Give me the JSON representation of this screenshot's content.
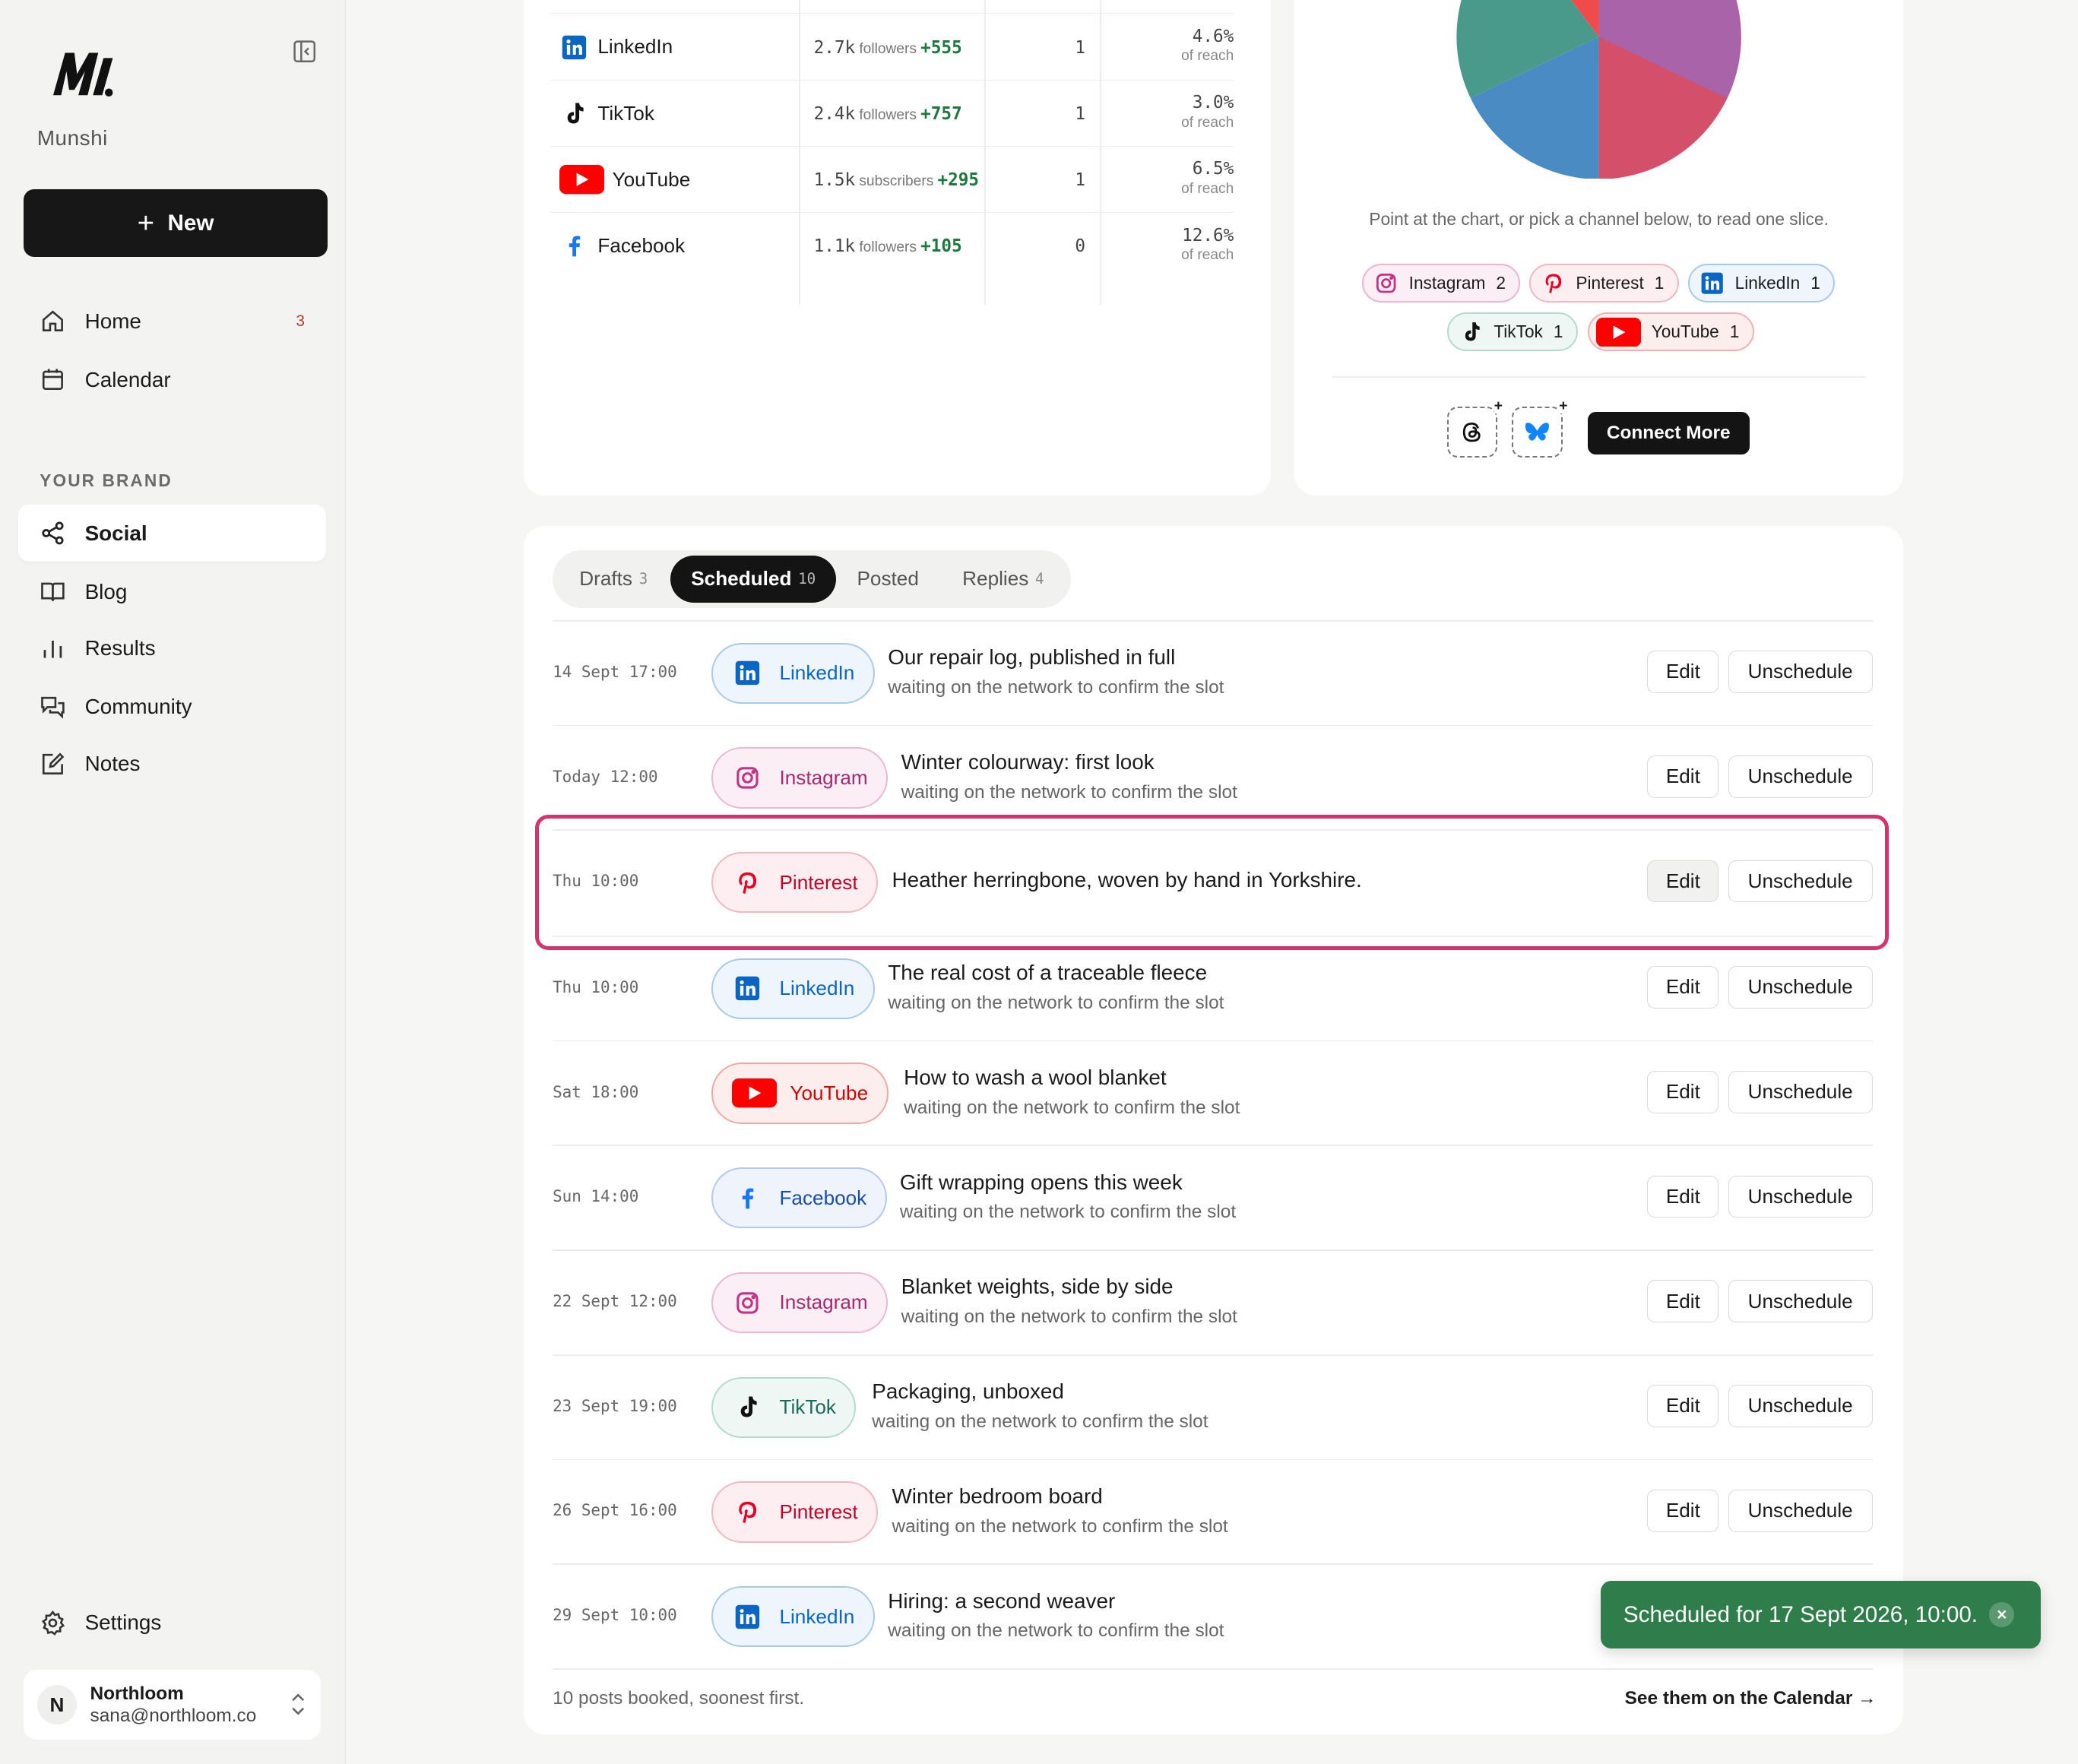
{
  "brand": {
    "name": "Munshi"
  },
  "sidebar": {
    "new_label": "New",
    "nav": [
      {
        "label": "Home",
        "badge": "3",
        "icon": "home-icon"
      },
      {
        "label": "Calendar",
        "icon": "calendar-icon"
      }
    ],
    "section_label": "YOUR BRAND",
    "brand_nav": [
      {
        "label": "Social",
        "icon": "share-icon",
        "active": true
      },
      {
        "label": "Blog",
        "icon": "book-icon"
      },
      {
        "label": "Results",
        "icon": "bar-chart-icon"
      },
      {
        "label": "Community",
        "icon": "chat-icon"
      },
      {
        "label": "Notes",
        "icon": "edit-note-icon"
      }
    ],
    "settings_label": "Settings",
    "account": {
      "initial": "N",
      "name": "Northloom",
      "email": "sana@northloom.co"
    }
  },
  "stats": {
    "rows": [
      {
        "network": "LinkedIn",
        "followers": "2.7k",
        "unit": "followers",
        "delta": "+555",
        "posts": "1",
        "reach": "4.6%",
        "reach_label": "of reach"
      },
      {
        "network": "TikTok",
        "followers": "2.4k",
        "unit": "followers",
        "delta": "+757",
        "posts": "1",
        "reach": "3.0%",
        "reach_label": "of reach"
      },
      {
        "network": "YouTube",
        "followers": "1.5k",
        "unit": "subscribers",
        "delta": "+295",
        "posts": "1",
        "reach": "6.5%",
        "reach_label": "of reach"
      },
      {
        "network": "Facebook",
        "followers": "1.1k",
        "unit": "followers",
        "delta": "+105",
        "posts": "0",
        "reach": "12.6%",
        "reach_label": "of reach"
      }
    ]
  },
  "pie": {
    "hint": "Point at the chart, or pick a channel below, to read one slice.",
    "chips": [
      {
        "label": "Instagram",
        "count": "2"
      },
      {
        "label": "Pinterest",
        "count": "1"
      },
      {
        "label": "LinkedIn",
        "count": "1"
      },
      {
        "label": "TikTok",
        "count": "1"
      },
      {
        "label": "YouTube",
        "count": "1"
      }
    ],
    "connect_label": "Connect More"
  },
  "tabs": [
    {
      "label": "Drafts",
      "count": "3"
    },
    {
      "label": "Scheduled",
      "count": "10",
      "active": true
    },
    {
      "label": "Posted",
      "count": ""
    },
    {
      "label": "Replies",
      "count": "4"
    }
  ],
  "posts": [
    {
      "when": "14 Sept 17:00",
      "network": "LinkedIn",
      "title": "Our repair log, published in full",
      "sub": "waiting on the network to confirm the slot"
    },
    {
      "when": "Today 12:00",
      "network": "Instagram",
      "title": "Winter colourway: first look",
      "sub": "waiting on the network to confirm the slot"
    },
    {
      "when": "Thu 10:00",
      "network": "Pinterest",
      "title": "Heather herringbone, woven by hand in Yorkshire.",
      "sub": ""
    },
    {
      "when": "Thu 10:00",
      "network": "LinkedIn",
      "title": "The real cost of a traceable fleece",
      "sub": "waiting on the network to confirm the slot"
    },
    {
      "when": "Sat 18:00",
      "network": "YouTube",
      "title": "How to wash a wool blanket",
      "sub": "waiting on the network to confirm the slot"
    },
    {
      "when": "Sun 14:00",
      "network": "Facebook",
      "title": "Gift wrapping opens this week",
      "sub": "waiting on the network to confirm the slot"
    },
    {
      "when": "22 Sept 12:00",
      "network": "Instagram",
      "title": "Blanket weights, side by side",
      "sub": "waiting on the network to confirm the slot"
    },
    {
      "when": "23 Sept 19:00",
      "network": "TikTok",
      "title": "Packaging, unboxed",
      "sub": "waiting on the network to confirm the slot"
    },
    {
      "when": "26 Sept 16:00",
      "network": "Pinterest",
      "title": "Winter bedroom board",
      "sub": "waiting on the network to confirm the slot"
    },
    {
      "when": "29 Sept 10:00",
      "network": "LinkedIn",
      "title": "Hiring: a second weaver",
      "sub": "waiting on the network to confirm the slot"
    }
  ],
  "actions": {
    "edit": "Edit",
    "unschedule": "Unschedule"
  },
  "footer": {
    "summary": "10 posts booked, soonest first.",
    "link": "See them on the Calendar →"
  },
  "toast": {
    "message": "Scheduled for 17 Sept 2026, 10:00.",
    "close": "×"
  },
  "colors": {
    "linkedin": "#0a66c2",
    "instagram": "#c13584",
    "pinterest": "#e60023",
    "youtube": "#ff0000",
    "facebook": "#1877f2",
    "tiktok": "#111111",
    "toast": "#2e7d4a",
    "focus": "#d6336c"
  }
}
